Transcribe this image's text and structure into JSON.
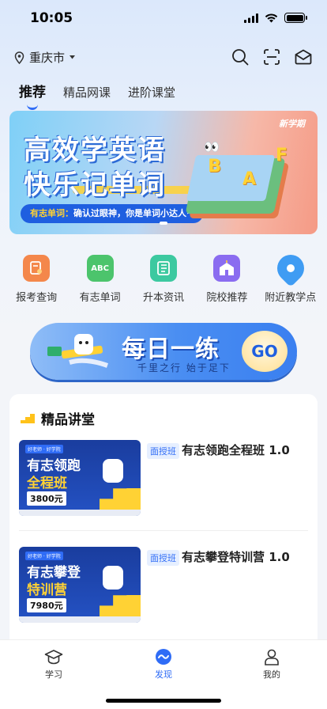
{
  "status_bar": {
    "time": "10:05"
  },
  "header": {
    "city": "重庆市"
  },
  "tabs": [
    {
      "label": "推荐",
      "active": true
    },
    {
      "label": "精品网课",
      "active": false
    },
    {
      "label": "进阶课堂",
      "active": false
    }
  ],
  "banner": {
    "title_line1": "高效学英语",
    "title_line2": "快乐记单词",
    "pill_highlight": "有志单词：",
    "pill_text": "确认过眼神，你是单词小达人~",
    "badge": "新学期",
    "letters": [
      "B",
      "A",
      "F"
    ]
  },
  "quick_nav": [
    {
      "label": "报考查询",
      "icon": "report-icon",
      "color": "#f4874b",
      "glyph": ""
    },
    {
      "label": "有志单词",
      "icon": "abc-icon",
      "color": "#4cc46c",
      "glyph": "ABC"
    },
    {
      "label": "升本资讯",
      "icon": "news-icon",
      "color": "#3cc9a0",
      "glyph": ""
    },
    {
      "label": "院校推荐",
      "icon": "school-icon",
      "color": "#8a6cf0",
      "glyph": ""
    },
    {
      "label": "附近教学点",
      "icon": "location-pin-icon",
      "color": "#3f9cf3",
      "glyph": ""
    }
  ],
  "daily": {
    "title": "每日一练",
    "subtitle": "千里之行  始于足下",
    "go_label": "GO"
  },
  "section": {
    "title": "精品讲堂",
    "courses": [
      {
        "tag": "面授班",
        "name": "有志领跑全程班 1.0",
        "thumb_line1": "有志领跑",
        "thumb_line2": "全程班",
        "price": "3800元"
      },
      {
        "tag": "面授班",
        "name": "有志攀登特训营 1.0",
        "thumb_line1": "有志攀登",
        "thumb_line2": "特训营",
        "price": "7980元"
      }
    ]
  },
  "tabbar": [
    {
      "label": "学习",
      "icon": "graduation-cap-icon",
      "active": false
    },
    {
      "label": "发现",
      "icon": "discover-icon",
      "active": true
    },
    {
      "label": "我的",
      "icon": "profile-icon",
      "active": false
    }
  ],
  "colors": {
    "accent": "#2f6cf6",
    "highlight": "#ffd234"
  }
}
